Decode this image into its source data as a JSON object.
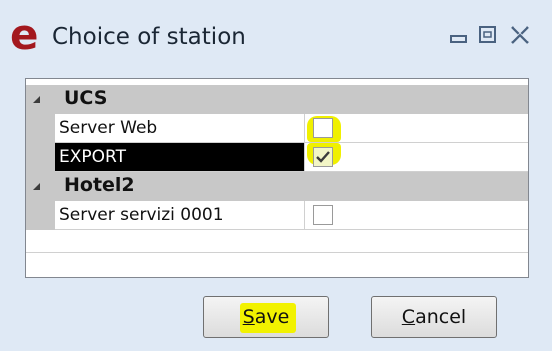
{
  "window": {
    "title": "Choice of station",
    "colors": {
      "app_icon": "#a3181e",
      "highlight": "#f0f000",
      "selected_row": "#000000"
    }
  },
  "groups": [
    {
      "name": "UCS",
      "items": [
        {
          "name": "Server Web",
          "checked": false,
          "selected": false
        },
        {
          "name": "EXPORT",
          "checked": true,
          "selected": true
        }
      ]
    },
    {
      "name": "Hotel2",
      "items": [
        {
          "name": "Server servizi 0001",
          "checked": false,
          "selected": false
        }
      ]
    }
  ],
  "buttons": {
    "save": {
      "accel": "S",
      "rest": "ave"
    },
    "cancel": {
      "accel": "C",
      "rest": "ancel"
    }
  }
}
